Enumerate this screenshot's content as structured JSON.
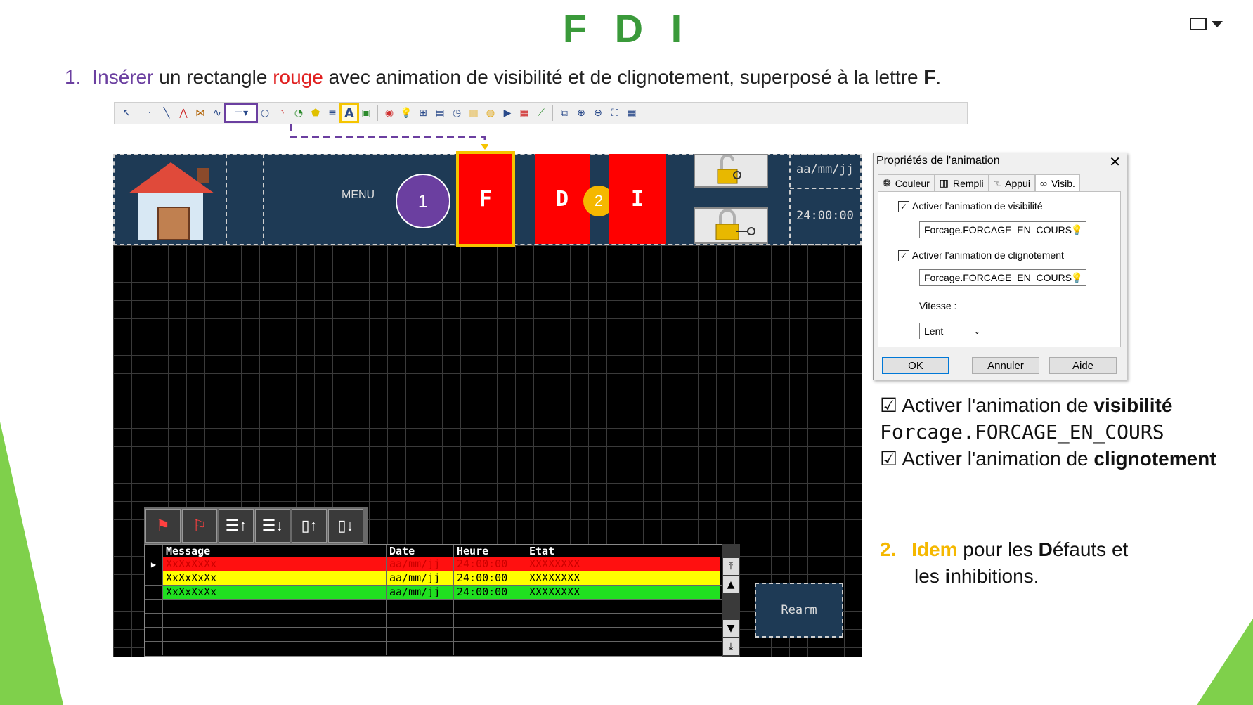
{
  "slide": {
    "title": "F D I",
    "step1": {
      "number": "1.",
      "verb": "Insérer",
      "text_a": " un rectangle ",
      "color_word": "rouge",
      "text_b": " avec animation de visibilité et de clignotement, superposé à la lettre ",
      "letter": "F",
      "end": "."
    },
    "step2": {
      "number": "2.",
      "idem": "Idem",
      "text_a": " pour les ",
      "bold_d": "D",
      "text_b": "éfauts et",
      "text_c": "les ",
      "bold_i": "i",
      "text_d": "nhibitions."
    },
    "summary": {
      "check1_prefix": "☑ Activer l'animation de ",
      "check1_bold": "visibilité",
      "variable": "Forcage.FORCAGE_EN_COURS",
      "check2_prefix": "☑ Activer l'animation de ",
      "check2_bold": "clignotement"
    }
  },
  "hmi": {
    "menu_label": "MENU",
    "callout1": "1",
    "callout2": "2",
    "btn_f": "F",
    "btn_d": "D",
    "btn_i": "I",
    "date": "aa/mm/jj",
    "time": "24:00:00",
    "rearm": "Rearm",
    "alarm_table": {
      "headers": [
        "Message",
        "Date",
        "Heure",
        "Etat"
      ],
      "rows": [
        {
          "message": "XxXxXxXx",
          "date": "aa/mm/jj",
          "heure": "24:00:00",
          "etat": "XXXXXXXX"
        },
        {
          "message": "XxXxXxXx",
          "date": "aa/mm/jj",
          "heure": "24:00:00",
          "etat": "XXXXXXXX"
        },
        {
          "message": "XxXxXxXx",
          "date": "aa/mm/jj",
          "heure": "24:00:00",
          "etat": "XXXXXXXX"
        }
      ]
    }
  },
  "dialog": {
    "title": "Propriétés de l'animation",
    "close": "✕",
    "tabs": [
      "Couleur",
      "Rempli",
      "Appui",
      "Visib."
    ],
    "visibility_label": "Activer l'animation de visibilité",
    "visibility_var": "Forcage.FORCAGE_EN_COURS",
    "blink_label": "Activer l'animation de clignotement",
    "blink_var": "Forcage.FORCAGE_EN_COURS",
    "speed_label": "Vitesse :",
    "speed_value": "Lent",
    "ok": "OK",
    "cancel": "Annuler",
    "help": "Aide"
  },
  "colors": {
    "title_green": "#3a9a3a",
    "purple": "#6b3fa0",
    "yellow": "#f5c400",
    "hmi_blue": "#1e3a55",
    "alarm_red": "#ff0000"
  }
}
